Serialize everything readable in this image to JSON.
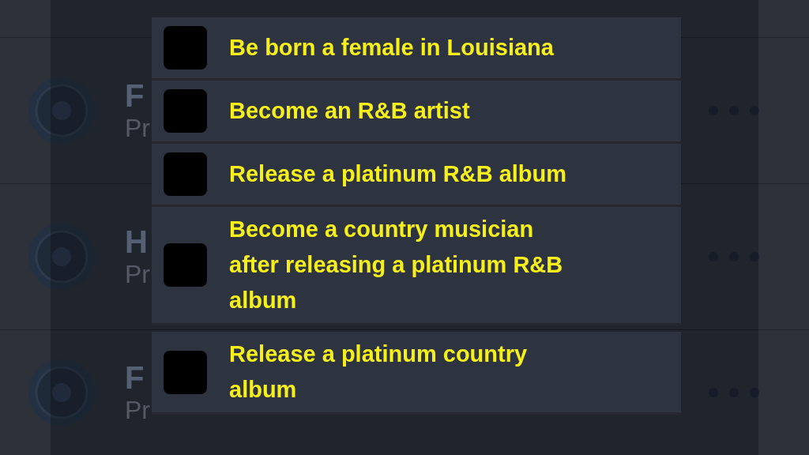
{
  "background_list": [
    {
      "title": "F",
      "subtitle": "Pr"
    },
    {
      "title": "H",
      "subtitle": "Pr"
    },
    {
      "title": "F",
      "subtitle": "Pr"
    }
  ],
  "checklist": [
    {
      "text": "Be born a female in Louisiana",
      "checked": false
    },
    {
      "text": "Become an R&B artist",
      "checked": false
    },
    {
      "text": "Release a platinum R&B album",
      "checked": false
    },
    {
      "text": "Become a country musician after releasing a platinum R&B album",
      "checked": false
    },
    {
      "text": "Release a platinum country album",
      "checked": false
    }
  ]
}
